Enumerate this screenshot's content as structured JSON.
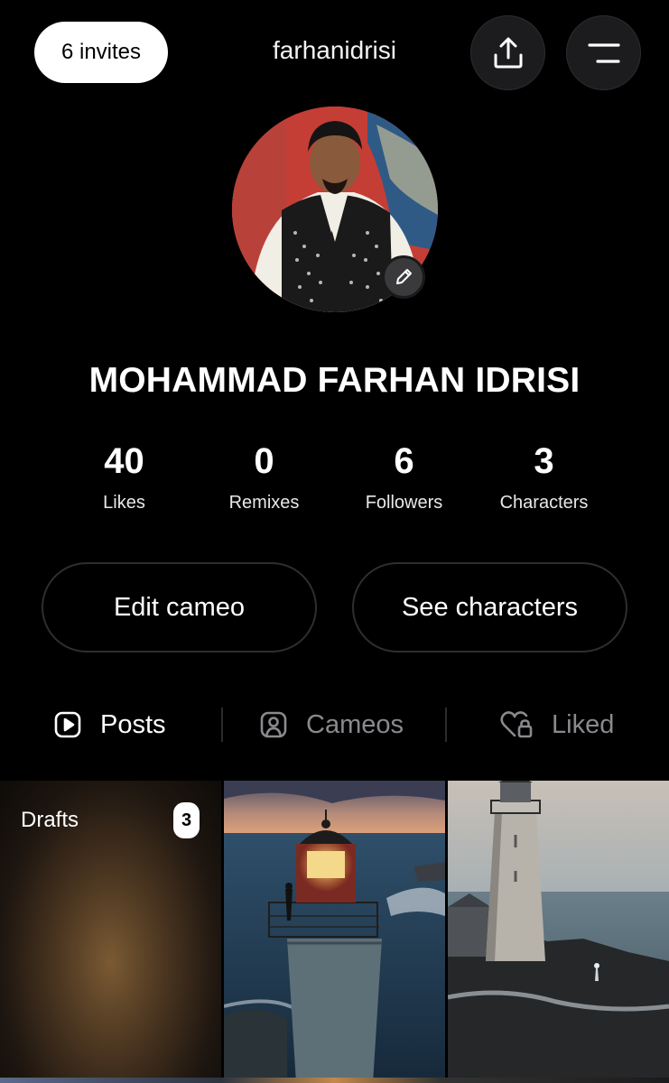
{
  "header": {
    "invites_label": "6 invites",
    "username": "farhanidrisi",
    "share_icon": "share-icon",
    "menu_icon": "menu-icon"
  },
  "profile": {
    "display_name": "MOHAMMAD FARHAN IDRISI",
    "edit_icon": "pencil-icon"
  },
  "stats": [
    {
      "value": "40",
      "label": "Likes"
    },
    {
      "value": "0",
      "label": "Remixes"
    },
    {
      "value": "6",
      "label": "Followers"
    },
    {
      "value": "3",
      "label": "Characters"
    }
  ],
  "actions": {
    "edit_cameo": "Edit cameo",
    "see_characters": "See characters"
  },
  "tabs": [
    {
      "label": "Posts",
      "icon": "play-square-icon",
      "active": true
    },
    {
      "label": "Cameos",
      "icon": "person-square-icon",
      "active": false
    },
    {
      "label": "Liked",
      "icon": "heart-lock-icon",
      "active": false
    }
  ],
  "grid": {
    "drafts_label": "Drafts",
    "drafts_count": "3"
  },
  "colors": {
    "background": "#000000",
    "active_tab": "#ffffff",
    "inactive_tab": "#8a8a8e",
    "button_border": "#2e2e30"
  }
}
